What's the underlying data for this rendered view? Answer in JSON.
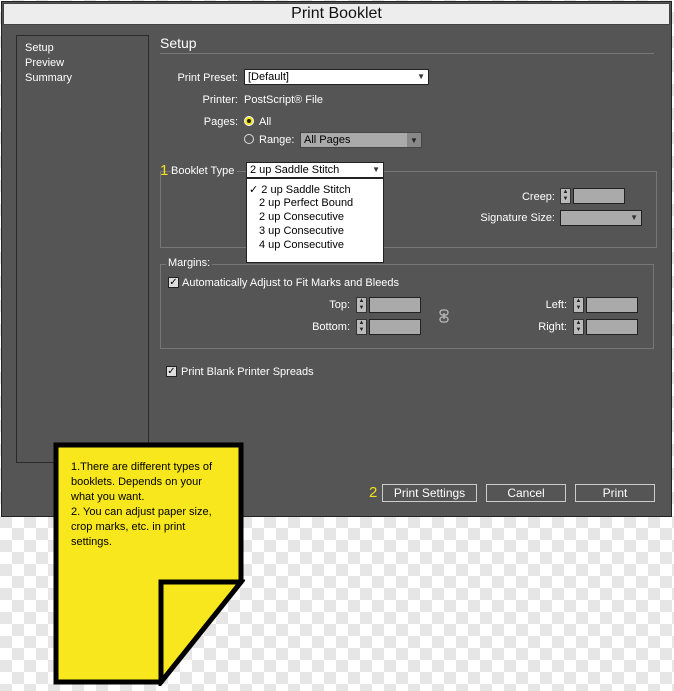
{
  "window": {
    "title": "Print Booklet"
  },
  "sidebar": {
    "items": [
      {
        "label": "Setup"
      },
      {
        "label": "Preview"
      },
      {
        "label": "Summary"
      }
    ]
  },
  "setup": {
    "heading": "Setup",
    "print_preset_label": "Print Preset:",
    "print_preset_value": "[Default]",
    "printer_label": "Printer:",
    "printer_value": "PostScript® File",
    "pages_label": "Pages:",
    "pages_all_label": "All",
    "pages_range_label": "Range:",
    "pages_range_value": "All Pages"
  },
  "booklet": {
    "step_number": "1",
    "type_label": "Booklet Type",
    "type_value": "2 up Saddle Stitch",
    "options": [
      {
        "label": "✓ 2 up Saddle Stitch"
      },
      {
        "label": "2 up Perfect Bound"
      },
      {
        "label": "2 up Consecutive"
      },
      {
        "label": "3 up Consecutive"
      },
      {
        "label": "4 up Consecutive"
      }
    ],
    "creep_label": "Creep:",
    "signature_label": "Signature Size:"
  },
  "margins": {
    "heading": "Margins:",
    "auto_adjust_label": "Automatically Adjust to Fit Marks and Bleeds",
    "top_label": "Top:",
    "bottom_label": "Bottom:",
    "left_label": "Left:",
    "right_label": "Right:"
  },
  "print_blank_label": "Print Blank Printer Spreads",
  "buttons": {
    "step_number": "2",
    "print_settings": "Print Settings",
    "cancel": "Cancel",
    "print": "Print"
  },
  "note": {
    "text": "1.There are different types of\nbooklets. Depends on your\nwhat you want.\n2. You can adjust paper size,\ncrop marks, etc. in print\nsettings."
  },
  "colors": {
    "dialog_bg": "#555555",
    "accent_yellow": "#f3e21a",
    "note_yellow": "#f8e71c"
  }
}
